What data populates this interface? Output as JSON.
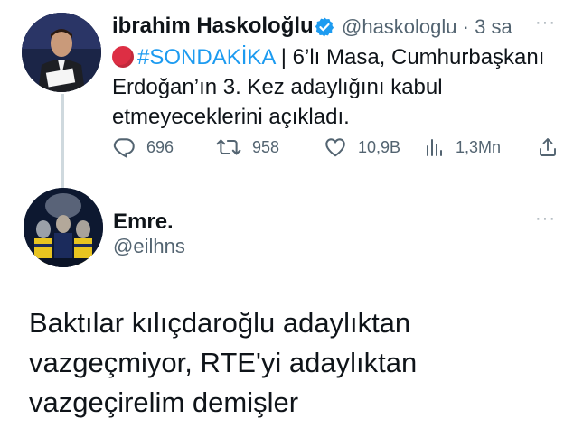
{
  "tweet": {
    "author_name": "ibrahim Haskoloğlu",
    "author_handle": "@haskologlu",
    "separator": "·",
    "time": "3 sa",
    "text_hashtag": "#SONDAKİKA",
    "text_line": " | 6’lı Masa, Cumhurbaşkanı Erdoğan’ın 3. Kez adaylığını kabul etmeyeceklerini açıkladı.",
    "replies": "696",
    "retweets": "958",
    "likes": "10,9B",
    "views": "1,3Mn",
    "more_label": "···"
  },
  "reply": {
    "author_name": "Emre.",
    "author_handle": "@eilhns",
    "more_label": "···",
    "text": "Baktılar kılıçdaroğlu adaylıktan vazgeçmiyor, RTE'yi adaylıktan vazgeçirelim demişler"
  },
  "colors": {
    "accent": "#1d9bf0",
    "secondary_text": "#536471",
    "alert_red": "#dd2e44"
  },
  "icons": [
    "verified-badge-icon",
    "red-circle-emoji",
    "reply-icon",
    "retweet-icon",
    "like-icon",
    "views-icon",
    "share-icon",
    "more-icon"
  ]
}
